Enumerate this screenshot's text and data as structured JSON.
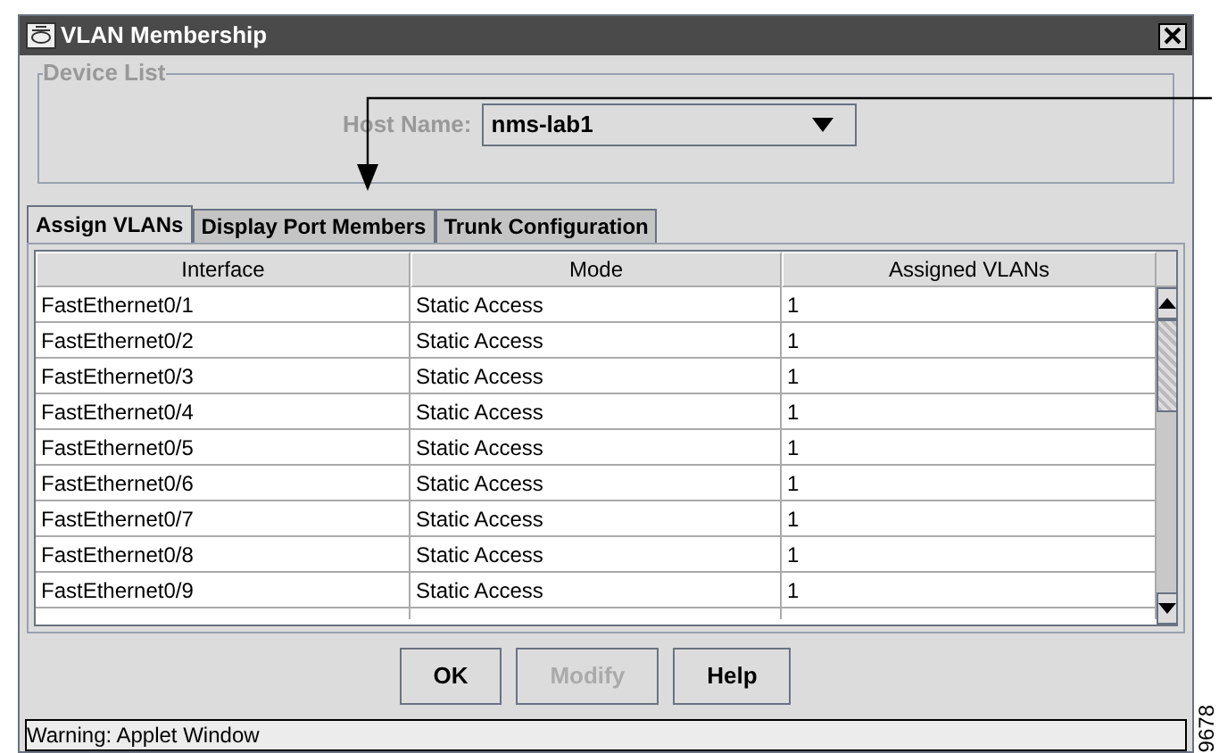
{
  "window": {
    "title": "VLAN Membership"
  },
  "device_list": {
    "title": "Device List",
    "host_name_label": "Host Name:",
    "host_name_value": "nms-lab1"
  },
  "tabs": [
    {
      "label": "Assign VLANs",
      "selected": true
    },
    {
      "label": "Display Port Members",
      "selected": false
    },
    {
      "label": "Trunk Configuration",
      "selected": false
    }
  ],
  "table": {
    "columns": [
      "Interface",
      "Mode",
      "Assigned VLANs"
    ],
    "rows": [
      [
        "FastEthernet0/1",
        "Static Access",
        "1"
      ],
      [
        "FastEthernet0/2",
        "Static Access",
        "1"
      ],
      [
        "FastEthernet0/3",
        "Static Access",
        "1"
      ],
      [
        "FastEthernet0/4",
        "Static Access",
        "1"
      ],
      [
        "FastEthernet0/5",
        "Static Access",
        "1"
      ],
      [
        "FastEthernet0/6",
        "Static Access",
        "1"
      ],
      [
        "FastEthernet0/7",
        "Static Access",
        "1"
      ],
      [
        "FastEthernet0/8",
        "Static Access",
        "1"
      ],
      [
        "FastEthernet0/9",
        "Static Access",
        "1"
      ]
    ]
  },
  "buttons": [
    {
      "label": "OK",
      "disabled": false
    },
    {
      "label": "Modify",
      "disabled": true
    },
    {
      "label": "Help",
      "disabled": false
    }
  ],
  "status_bar": "Warning: Applet Window",
  "figure_number": "9678"
}
